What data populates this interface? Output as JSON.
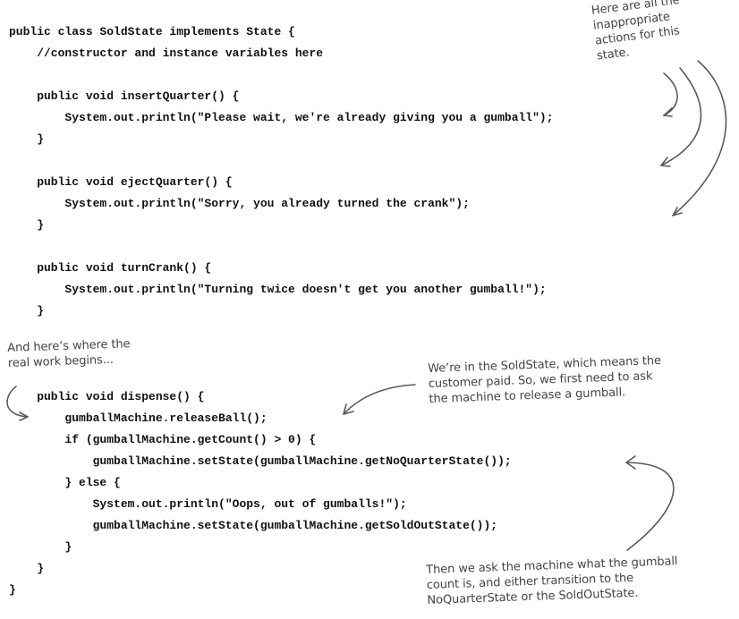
{
  "code_lines": [
    "public class SoldState implements State {",
    "    //constructor and instance variables here",
    "",
    "    public void insertQuarter() {",
    "        System.out.println(\"Please wait, we're already giving you a gumball\");",
    "    }",
    "",
    "    public void ejectQuarter() {",
    "        System.out.println(\"Sorry, you already turned the crank\");",
    "    }",
    "",
    "    public void turnCrank() {",
    "        System.out.println(\"Turning twice doesn't get you another gumball!\");",
    "    }",
    "",
    "",
    "    public void dispense() {",
    "        gumballMachine.releaseBall();",
    "        if (gumballMachine.getCount() > 0) {",
    "            gumballMachine.setState(gumballMachine.getNoQuarterState());",
    "        } else {",
    "            System.out.println(\"Oops, out of gumballs!\");",
    "            gumballMachine.setState(gumballMachine.getSoldOutState());",
    "        }",
    "    }",
    "}"
  ],
  "annotations": {
    "inappropriate_actions": [
      "Here are all the",
      "inappropriate",
      "actions for this",
      "state."
    ],
    "real_work": [
      "And here’s where the",
      "real work begins..."
    ],
    "sold_state": [
      "We’re in the SoldState, which means the",
      "customer paid. So, we first need to ask",
      "the machine to release a gumball."
    ],
    "transition": [
      "Then we ask the machine what the gumball",
      "count is, and either transition to the",
      "NoQuarterState or the SoldOutState."
    ]
  },
  "colors": {
    "code_text": "#111111",
    "annotation_text": "#444444",
    "arrow": "#5a5a5a",
    "background": "#ffffff"
  }
}
